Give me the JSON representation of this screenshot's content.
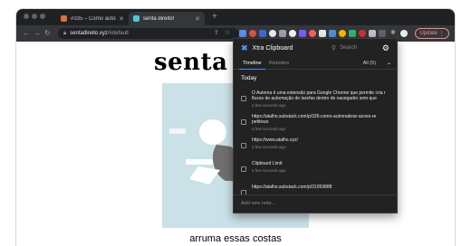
{
  "browser": {
    "tabs": [
      {
        "title": "#335 – Como automatizar açõ",
        "active": false,
        "favicon_color": "#e36b3c"
      },
      {
        "title": "senta direito!",
        "active": true,
        "favicon_color": "#4cc9d6"
      }
    ],
    "url": {
      "host": "sentadireito.xyz",
      "path": "/#default"
    },
    "update_label": "Update"
  },
  "page": {
    "site_title": "senta d",
    "caption": "arruma essas costas",
    "hero_color": "#c9e1e7"
  },
  "popup": {
    "app_name": "Xtra Clipboard",
    "search_placeholder": "Search",
    "tabs": [
      "Timeline",
      "Websites"
    ],
    "filter_label": "All (5)",
    "section_heading": "Today",
    "items": [
      {
        "text": "O Automa é uma extensão para Google Chrome que permite cria r fluxos de automação de tarefas dentro do navegador sem que",
        "time": "a few seconds ago"
      },
      {
        "text": "https://atalho.substack.com/p/335-como-automatizar-acoes-re petitivas",
        "time": "a few seconds ago"
      },
      {
        "text": "https://www.atalho.xyz/",
        "time": "a few seconds ago"
      },
      {
        "text": "Clipboard Limit",
        "time": "a few seconds ago"
      },
      {
        "text": "https://atalho.substack.com/p/31059888",
        "time": ""
      }
    ],
    "note_placeholder": "Add new note..."
  },
  "colors": {
    "accent": "#4d8eff",
    "popup_bg": "#222222",
    "chrome_dark": "#202124"
  },
  "icons": [
    "back-arrow-icon",
    "forward-arrow-icon",
    "reload-icon",
    "lock-icon",
    "share-icon",
    "star-icon",
    "extensions-icon",
    "profile-icon",
    "gear-icon",
    "search-icon",
    "chevron-down-icon",
    "xtra-clipboard-logo-icon"
  ]
}
